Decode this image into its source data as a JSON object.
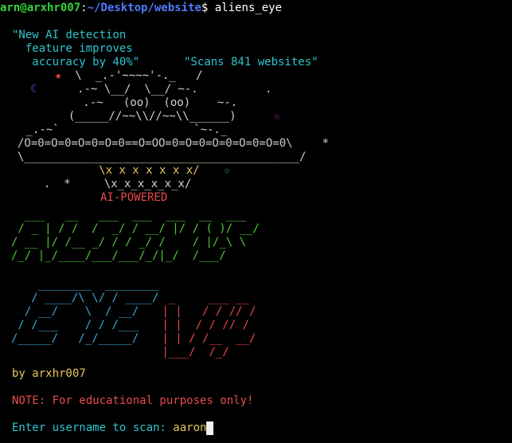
{
  "prompt": {
    "user_host": "arn@arxhr007",
    "separator": ":",
    "path": "~/Desktop/website",
    "dollar": "$ ",
    "command": "aliens_eye"
  },
  "banner": {
    "quote_left_1": "\"New AI detection",
    "quote_left_2": "  feature improves",
    "quote_left_3": "   accuracy by 40%\"",
    "quote_right": "\"Scans 841 websites\"",
    "art": {
      "row1_star": "★",
      "row1_text": "  \\  _.-'~~~~'-._   /",
      "row2_moon": "☾",
      "row2_text": "      .-~ \\__/  \\__/ ~-.          .",
      "row3_text": "   .-~   (oo)  (oo)    ~-.",
      "row4_text": "  (_____//~~\\\\//~~\\\\______)",
      "row4_sparkle": "☆",
      "row5_text": " _.-~`                    `~-._",
      "row6_band": "/O=0=O=0=O=0=O=0==O=OO=0=O=0=O=0=O=0=O=0\\",
      "row6_star": "*",
      "row7_text": "\\_________________________________________/",
      "row8_text": "            \\x x x x x x x/",
      "row8_sparkle": "☆",
      "row9_text": "  .  *     \\x_x_x_x_x_x/",
      "powered": "AI-POWERED"
    }
  },
  "logo1": [
    "  ___   __   ___  ___  ___  __  ___ ",
    " / _ | / /  /  _/ / __/ |/ / ( )/ __/",
    "/ __ |/ /__ _/ / / _/ /    / |/_\\ \\  ",
    "/_/ |_/____/___/___/_/|_/  /___/  "
  ],
  "logo2": [
    "    ________  ________",
    "   / ____/\\ \\/ / ____/",
    "  / __/    \\  / __/",
    " / /___    / / /___",
    "/_____/   /_/_____/"
  ],
  "logo2_right": [
    "  _     ___ __",
    " | |   / / // /",
    " | |  / / // /",
    " | | / /__  __/",
    " |___/  /_/"
  ],
  "footer": {
    "by": "by arxhr007",
    "note": "NOTE: For educational purposes only!",
    "enter_label": "Enter username to scan: ",
    "enter_value": "aaron"
  }
}
